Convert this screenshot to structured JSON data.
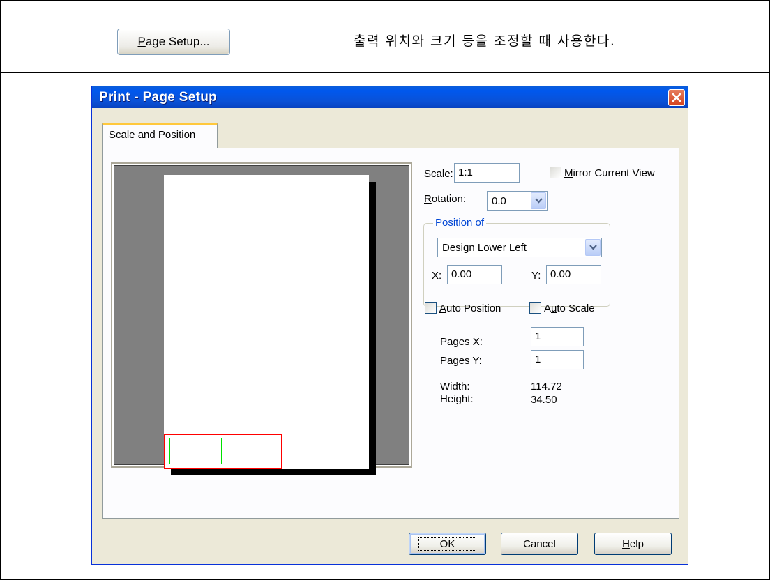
{
  "doc": {
    "button_label_prefix": "P",
    "button_label_rest": "age Setup...",
    "description": "출력 위치와 크기 등을 조정할 때 사용한다."
  },
  "dialog": {
    "title": "Print - Page Setup",
    "tab": "Scale and Position",
    "scale_label_u": "S",
    "scale_label_rest": "cale:",
    "scale_value": "1:1",
    "mirror_label_u": "M",
    "mirror_label_rest": "irror Current View",
    "mirror_checked": false,
    "rotation_label_u": "R",
    "rotation_label_rest": "otation:",
    "rotation_value": "0.0",
    "position_group_label": "Position of",
    "position_value": "Design Lower Left",
    "x_label_u": "X",
    "x_label_rest": ":",
    "x_value": "0.00",
    "y_label_u": "Y",
    "y_label_rest": ":",
    "y_value": "0.00",
    "auto_position_u": "A",
    "auto_position_rest": "uto Position",
    "auto_position_checked": false,
    "auto_scale_prefix": "A",
    "auto_scale_u": "u",
    "auto_scale_rest": "to Scale",
    "auto_scale_checked": false,
    "pages_x_u": "P",
    "pages_x_rest": "ages X:",
    "pages_x_value": "1",
    "pages_y_label": "Pages Y:",
    "pages_y_value": "1",
    "width_label": "Width:",
    "width_value": "114.72",
    "height_label": "Height:",
    "height_value": "34.50",
    "ok_label": "OK",
    "cancel_label": "Cancel",
    "help_u": "H",
    "help_rest": "elp"
  },
  "colors": {
    "title_bar": "#0a5ddb",
    "close_button": "#d5431f",
    "tab_highlight": "#ffc83c",
    "design_extent_outline": "#ff0000",
    "board_outline": "#00e000",
    "group_label": "#0046d5"
  }
}
